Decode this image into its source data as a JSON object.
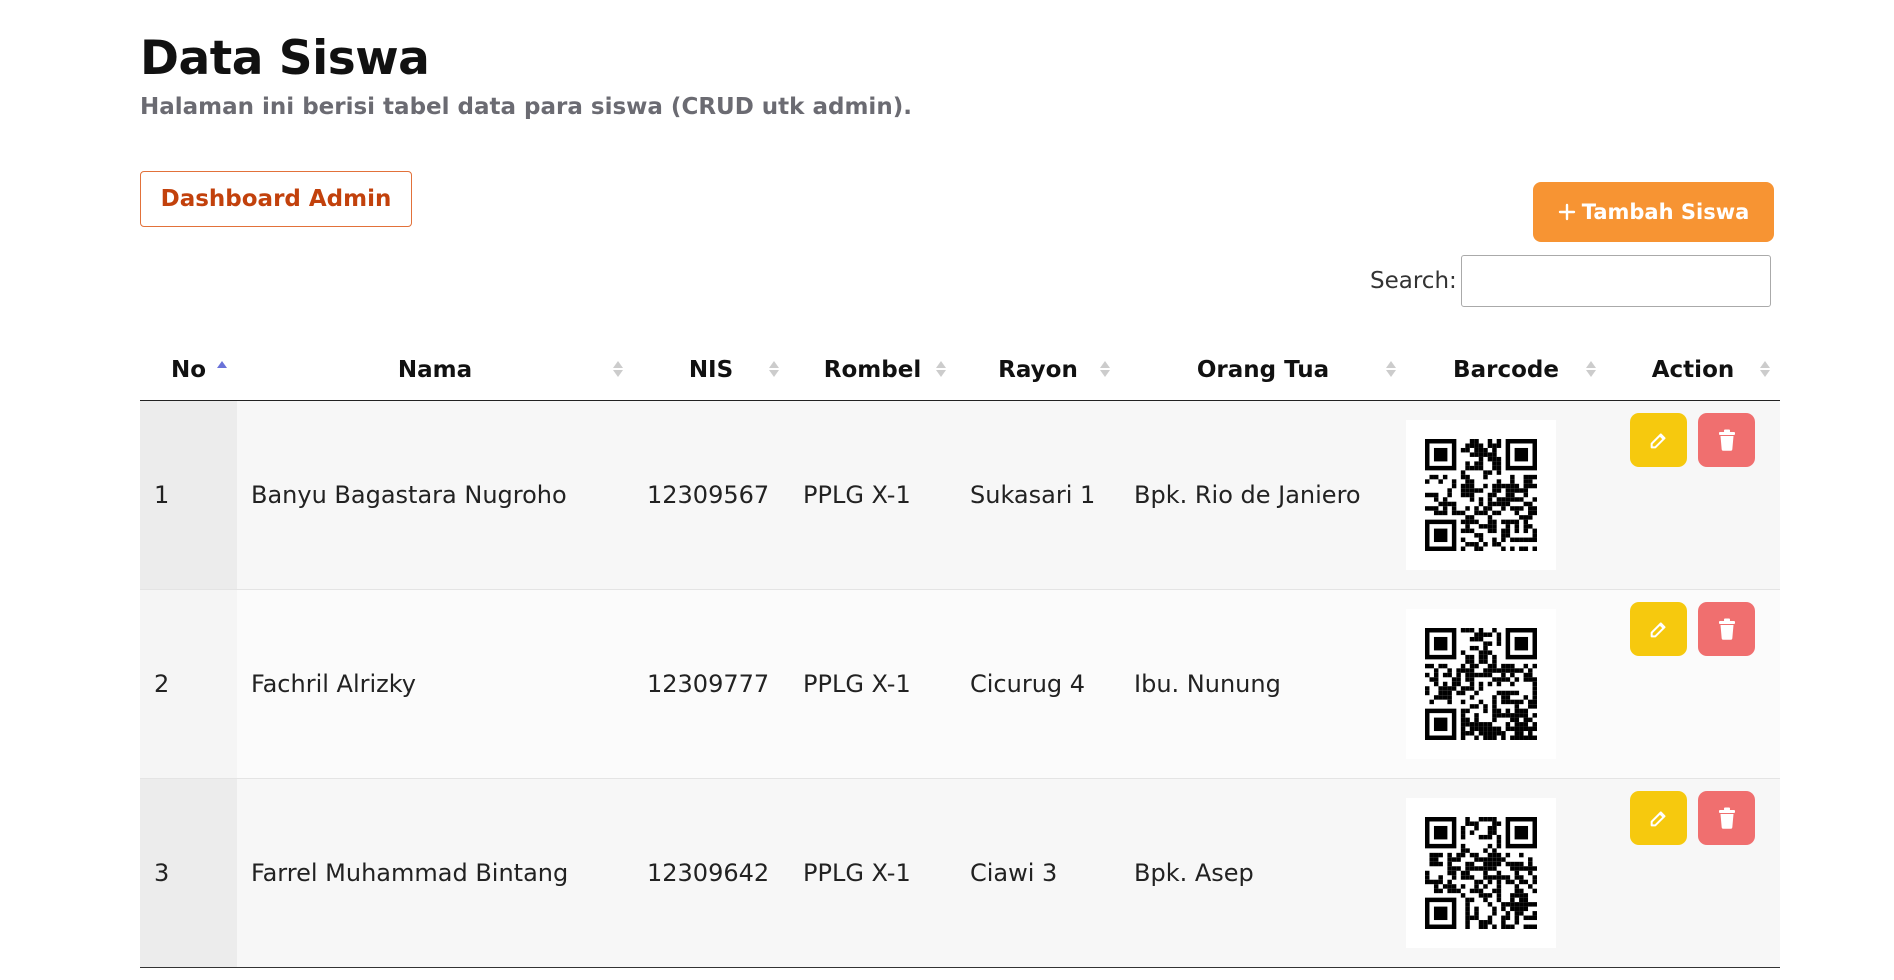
{
  "page": {
    "title": "Data Siswa",
    "subtitle": "Halaman ini berisi tabel data para siswa (CRUD utk admin)."
  },
  "actions": {
    "dashboard_label": "Dashboard Admin",
    "add_label": "Tambah Siswa",
    "add_icon": "plus-icon"
  },
  "search": {
    "label": "Search:",
    "value": ""
  },
  "table": {
    "columns": [
      "No",
      "Nama",
      "NIS",
      "Rombel",
      "Rayon",
      "Orang Tua",
      "Barcode",
      "Action"
    ],
    "sorted_column": "No",
    "sort_direction": "asc",
    "rows": [
      {
        "no": "1",
        "nama": "Banyu Bagastara Nugroho",
        "nis": "12309567",
        "rombel": "PPLG X-1",
        "rayon": "Sukasari 1",
        "orang_tua": "Bpk. Rio de Janiero"
      },
      {
        "no": "2",
        "nama": "Fachril Alrizky",
        "nis": "12309777",
        "rombel": "PPLG X-1",
        "rayon": "Cicurug 4",
        "orang_tua": "Ibu. Nunung"
      },
      {
        "no": "3",
        "nama": "Farrel Muhammad Bintang",
        "nis": "12309642",
        "rombel": "PPLG X-1",
        "rayon": "Ciawi 3",
        "orang_tua": "Bpk. Asep"
      }
    ],
    "row_actions": {
      "edit_icon": "edit-icon",
      "delete_icon": "trash-icon"
    }
  },
  "colors": {
    "accent_orange": "#f79433",
    "dashboard_border": "#e2713a",
    "edit_yellow": "#f6c90e",
    "delete_red": "#f06f6f",
    "sort_active": "#6a72d8"
  }
}
